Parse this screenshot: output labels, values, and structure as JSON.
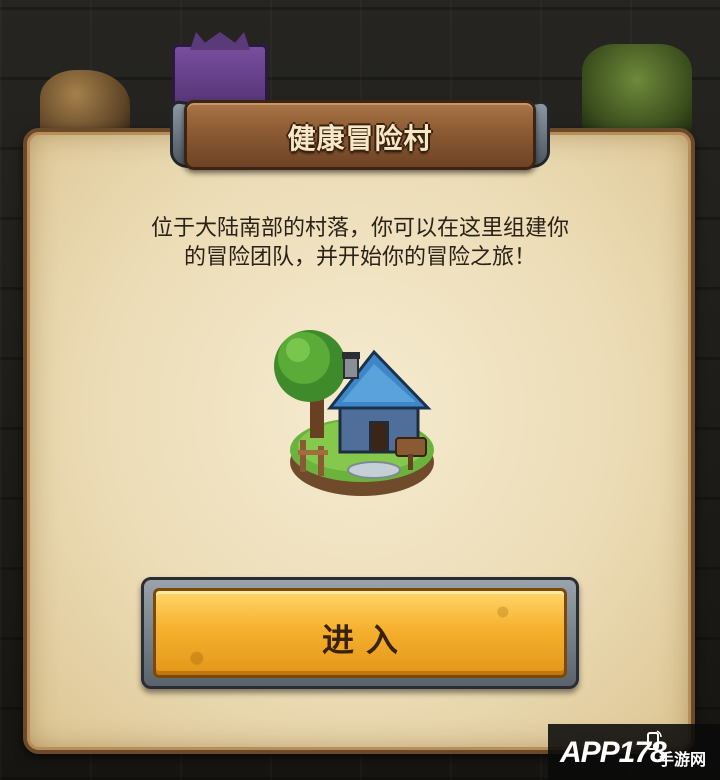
{
  "dialog": {
    "title": "健康冒险村",
    "description_line1": "位于大陆南部的村落，你可以在这里组建你",
    "description_line2": "的冒险团队，并开始你的冒险之旅！",
    "building_icon": "village-house-icon",
    "enter_label": "进入"
  },
  "watermark": {
    "brand": "APP178",
    "suffix": "手游网"
  },
  "colors": {
    "parchment": "#ecdcb6",
    "plaque_wood": "#8c5a33",
    "button_gold": "#f6b12e",
    "text_dark": "#2a2218"
  }
}
